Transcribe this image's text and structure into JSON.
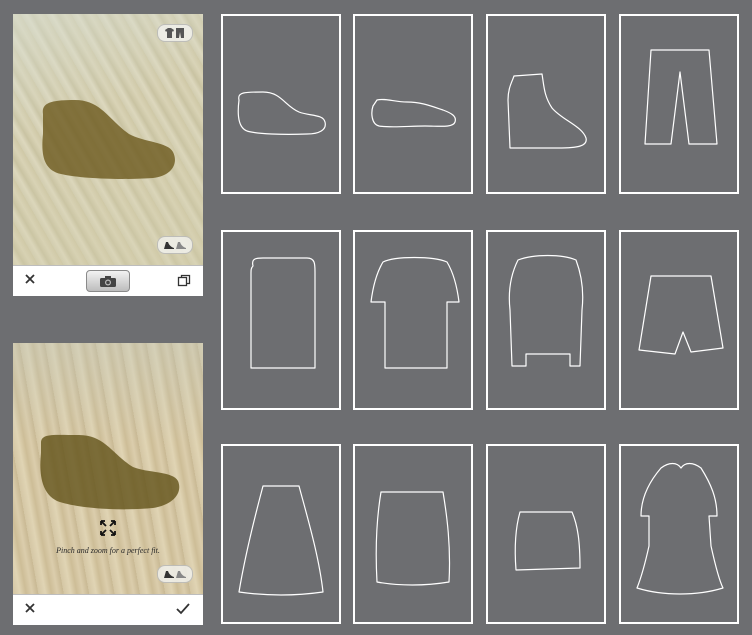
{
  "top_phone": {
    "badge_top_icon": "clothing-icon",
    "badge_bottom_icon": "shoes-icon",
    "toolbar": {
      "close_icon": "close-icon",
      "camera_icon": "camera-icon",
      "gallery_icon": "copy-icon"
    }
  },
  "bottom_phone": {
    "hint": "Pinch and zoom for a perfect fit.",
    "badge_bottom_icon": "shoes-icon",
    "toolbar": {
      "close_icon": "close-icon",
      "confirm_icon": "checkmark-icon"
    }
  },
  "templates": [
    {
      "name": "boot-low"
    },
    {
      "name": "sneaker"
    },
    {
      "name": "ankle-boot"
    },
    {
      "name": "trousers"
    },
    {
      "name": "rectangle-top"
    },
    {
      "name": "t-shirt"
    },
    {
      "name": "tunic"
    },
    {
      "name": "shorts"
    },
    {
      "name": "a-line-skirt"
    },
    {
      "name": "straight-skirt"
    },
    {
      "name": "mini-skirt"
    },
    {
      "name": "dress"
    }
  ],
  "colors": {
    "background": "#6d6e71",
    "outline": "#ffffff",
    "overlay_shape": "#6b5a1e"
  }
}
